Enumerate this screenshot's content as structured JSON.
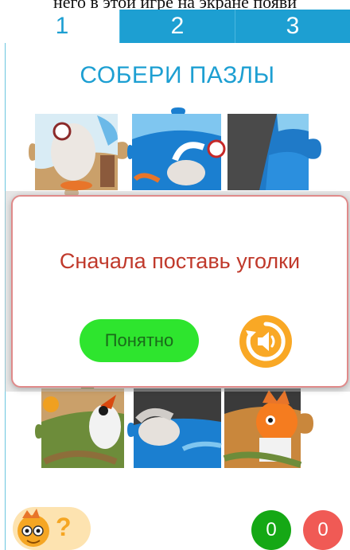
{
  "header": {
    "top_text": "него в этой игре на экране появи"
  },
  "tabs": [
    {
      "label": "1",
      "active": true
    },
    {
      "label": "2",
      "active": false
    },
    {
      "label": "3",
      "active": false
    }
  ],
  "title": "СОБЕРИ ПАЗЛЫ",
  "dialog": {
    "message": "Сначала поставь уголки",
    "ok_label": "Понятно",
    "sound_icon": "speaker-replay-icon"
  },
  "footer": {
    "help_icon": "dragon-mascot-icon",
    "help_mark": "?",
    "score_correct": "0",
    "score_wrong": "0"
  },
  "colors": {
    "accent": "#1d9fd2",
    "ok_button": "#2ee52e",
    "sound_button": "#f9a825",
    "dialog_text": "#c0392b",
    "score_correct": "#15a815",
    "score_wrong": "#f05a55"
  }
}
